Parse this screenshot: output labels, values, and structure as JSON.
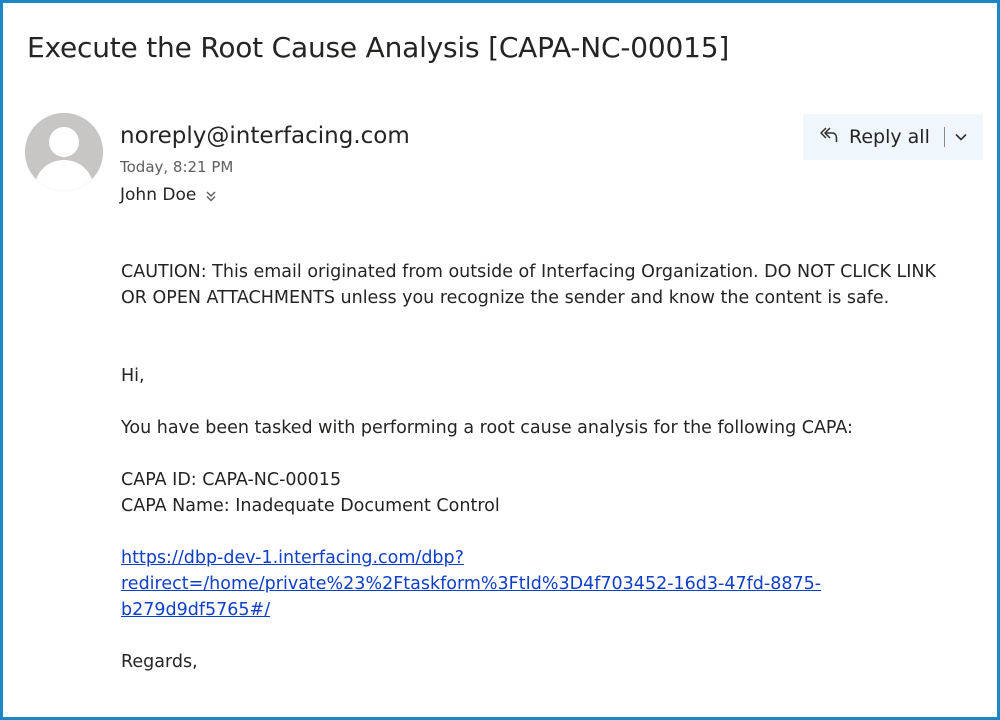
{
  "email": {
    "subject": "Execute the Root Cause Analysis [CAPA-NC-00015]",
    "sender": "noreply@interfacing.com",
    "date": "Today, 8:21 PM",
    "recipient": "John Doe",
    "reply_all_label": "Reply all",
    "body": {
      "caution_line1": "CAUTION: This email originated from outside of Interfacing Organization. DO NOT CLICK LINK",
      "caution_line2": "OR OPEN ATTACHMENTS unless you recognize the sender and know the content is safe.",
      "greeting": "Hi,",
      "task_text": "You have been tasked with performing a root cause analysis for the following CAPA:",
      "capa_id_line": "CAPA ID: CAPA-NC-00015",
      "capa_name_line": "CAPA Name: Inadequate Document Control",
      "link_line1": "https://dbp-dev-1.interfacing.com/dbp?",
      "link_line2": "redirect=/home/private%23%2Ftaskform%3FtId%3D4f703452-16d3-47fd-8875-",
      "link_line3": "b279d9df5765#/",
      "sign_off": "Regards,"
    }
  },
  "icons": {
    "avatar": "person-silhouette-icon",
    "reply_all": "reply-all-icon",
    "chevron": "chevron-down-icon",
    "expand": "double-chevron-down-icon"
  },
  "colors": {
    "frame_border": "#1b87c9",
    "link": "#0f3fc7",
    "reply_button_bg": "#eff6fc",
    "avatar_bg": "#c8c6c4"
  }
}
